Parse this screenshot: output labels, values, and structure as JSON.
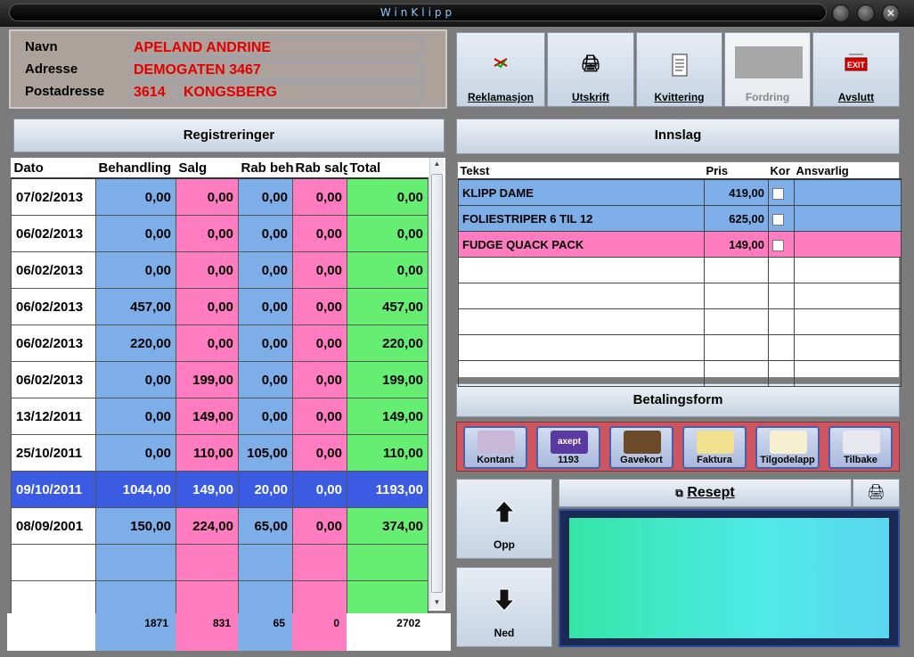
{
  "window": {
    "title": "WinKlipp",
    "controls": [
      "minimize",
      "maximize",
      "close"
    ],
    "close_glyph": "✕"
  },
  "customer": {
    "labels": {
      "name": "Navn",
      "address": "Adresse",
      "postal": "Postadresse"
    },
    "name": "APELAND ANDRINE",
    "address": "DEMOGATEN 3467",
    "postal_code": "3614",
    "city": "KONGSBERG"
  },
  "toolbar": {
    "reklamasjon": "Reklamasjon",
    "utskrift": "Utskrift",
    "kvittering": "Kvittering",
    "fordring": "Fordring",
    "avslutt": "Avslutt",
    "exit_sign": "EXIT"
  },
  "registreringer": {
    "title": "Registreringer",
    "columns": [
      "Dato",
      "Behandling",
      "Salg",
      "Rab beh",
      "Rab salg",
      "Total"
    ],
    "rows": [
      {
        "date": "07/02/2013",
        "beh": "0,00",
        "salg": "0,00",
        "rabbeh": "0,00",
        "rabsalg": "0,00",
        "total": "0,00"
      },
      {
        "date": "06/02/2013",
        "beh": "0,00",
        "salg": "0,00",
        "rabbeh": "0,00",
        "rabsalg": "0,00",
        "total": "0,00"
      },
      {
        "date": "06/02/2013",
        "beh": "0,00",
        "salg": "0,00",
        "rabbeh": "0,00",
        "rabsalg": "0,00",
        "total": "0,00"
      },
      {
        "date": "06/02/2013",
        "beh": "457,00",
        "salg": "0,00",
        "rabbeh": "0,00",
        "rabsalg": "0,00",
        "total": "457,00"
      },
      {
        "date": "06/02/2013",
        "beh": "220,00",
        "salg": "0,00",
        "rabbeh": "0,00",
        "rabsalg": "0,00",
        "total": "220,00"
      },
      {
        "date": "06/02/2013",
        "beh": "0,00",
        "salg": "199,00",
        "rabbeh": "0,00",
        "rabsalg": "0,00",
        "total": "199,00"
      },
      {
        "date": "13/12/2011",
        "beh": "0,00",
        "salg": "149,00",
        "rabbeh": "0,00",
        "rabsalg": "0,00",
        "total": "149,00"
      },
      {
        "date": "25/10/2011",
        "beh": "0,00",
        "salg": "110,00",
        "rabbeh": "105,00",
        "rabsalg": "0,00",
        "total": "110,00"
      },
      {
        "date": "09/10/2011",
        "beh": "1044,00",
        "salg": "149,00",
        "rabbeh": "20,00",
        "rabsalg": "0,00",
        "total": "1193,00",
        "selected": true
      },
      {
        "date": "08/09/2001",
        "beh": "150,00",
        "salg": "224,00",
        "rabbeh": "65,00",
        "rabsalg": "0,00",
        "total": "374,00"
      }
    ],
    "totals": {
      "beh": "1871",
      "salg": "831",
      "rabbeh": "65",
      "rabsalg": "0",
      "total": "2702"
    }
  },
  "innslag": {
    "title": "Innslag",
    "columns": [
      "Tekst",
      "Pris",
      "Kor",
      "Ansvarlig"
    ],
    "rows": [
      {
        "text": "KLIPP DAME",
        "price": "419,00",
        "color": "#7eaee8"
      },
      {
        "text": "FOLIESTRIPER 6 TIL 12",
        "price": "625,00",
        "color": "#7eaee8"
      },
      {
        "text": "FUDGE QUACK PACK",
        "price": "149,00",
        "color": "#ff7cc0"
      }
    ]
  },
  "betaling": {
    "title": "Betalingsform",
    "buttons": [
      {
        "label": "Kontant",
        "icon": "cash-icon"
      },
      {
        "label": "1193",
        "icon": "bankaxept-card-icon",
        "card_text": "axept"
      },
      {
        "label": "Gavekort",
        "icon": "gift-card-icon"
      },
      {
        "label": "Faktura",
        "icon": "invoice-icon"
      },
      {
        "label": "Tilgodelapp",
        "icon": "credit-note-icon"
      },
      {
        "label": "Tilbake",
        "icon": "return-icon"
      }
    ]
  },
  "nav": {
    "up": "Opp",
    "down": "Ned"
  },
  "resept": {
    "label": "Resept"
  },
  "colors": {
    "behandling": "#7eaee8",
    "salg": "#ff7cc0",
    "total": "#66ee72",
    "selected": "#3b5be3"
  }
}
